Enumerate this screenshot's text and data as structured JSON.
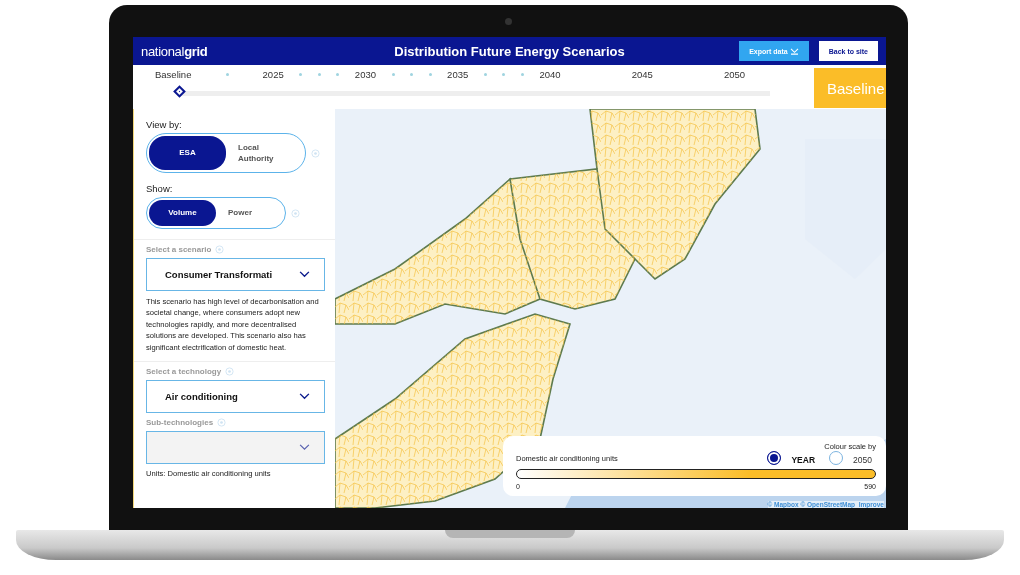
{
  "header": {
    "logo": "national**grid**",
    "title": "Distribution Future Energy Scenarios",
    "buttons": [
      {
        "label": "Export data",
        "kind": "export"
      },
      {
        "label": "Back to site",
        "kind": "plain"
      }
    ]
  },
  "timeline": {
    "items": [
      {
        "label": "Baseline",
        "kind": "start"
      },
      {
        "label": "2025",
        "kind": "single"
      },
      {
        "label": "2030",
        "kind": "triple"
      },
      {
        "label": "2035",
        "kind": "triple"
      },
      {
        "label": "2040",
        "kind": "triple"
      },
      {
        "label": "2045",
        "kind": "plain"
      },
      {
        "label": "2050",
        "kind": "plain"
      }
    ],
    "level": 0,
    "badge": "Baseline"
  },
  "sidebar": {
    "view_by": {
      "label": "View by:",
      "options": [
        {
          "label": "ESA",
          "selected": true
        },
        {
          "label": "Local Authority",
          "selected": false
        }
      ]
    },
    "show": {
      "label": "Show:",
      "options": [
        {
          "label": "Volume",
          "selected": true
        },
        {
          "label": "Power",
          "selected": false
        }
      ]
    },
    "scenario": {
      "label": "Select a scenario",
      "value": "Consumer Transformati",
      "description": "This scenario has high level of decarbonisation and societal change, where consumers adopt new technologies rapidly, and more decentralised solutions are developed. This scenario also has significant electrification of domestic heat."
    },
    "technology": {
      "label": "Select a technology",
      "value": "Air conditioning"
    },
    "sub_technologies": {
      "label": "Sub-technologies",
      "disabled": true
    },
    "units": "Units: Domestic air conditioning units"
  },
  "map": {
    "legend": {
      "title": "Domestic air conditioning units",
      "scale_label": "Colour scale by",
      "options": [
        {
          "label": "YEAR",
          "selected": true
        },
        {
          "label": "2050",
          "selected": false
        }
      ],
      "min": "0",
      "max": "590"
    },
    "attribution": "© Mapbox © OpenStreetMap  Improve"
  }
}
